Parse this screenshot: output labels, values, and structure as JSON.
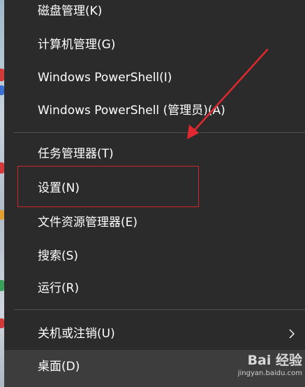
{
  "menu": {
    "items": [
      {
        "label": "磁盘管理(K)"
      },
      {
        "label": "计算机管理(G)"
      },
      {
        "label": "Windows PowerShell(I)"
      },
      {
        "label": "Windows PowerShell (管理员)(A)"
      },
      {
        "label": "任务管理器(T)"
      },
      {
        "label": "设置(N)"
      },
      {
        "label": "文件资源管理器(E)"
      },
      {
        "label": "搜索(S)"
      },
      {
        "label": "运行(R)"
      },
      {
        "label": "关机或注销(U)"
      },
      {
        "label": "桌面(D)"
      }
    ]
  },
  "annotation": {
    "highlight_color": "#d0242b",
    "arrow_color": "#e1282e"
  },
  "watermark": {
    "logo": "Bai 经验",
    "url": "jingyan.baidu.com"
  },
  "colors": {
    "menu_background": "#2b2b2b",
    "active_background": "#3d3d3d",
    "text": "#ffffff",
    "separator": "#4f4f4f"
  }
}
